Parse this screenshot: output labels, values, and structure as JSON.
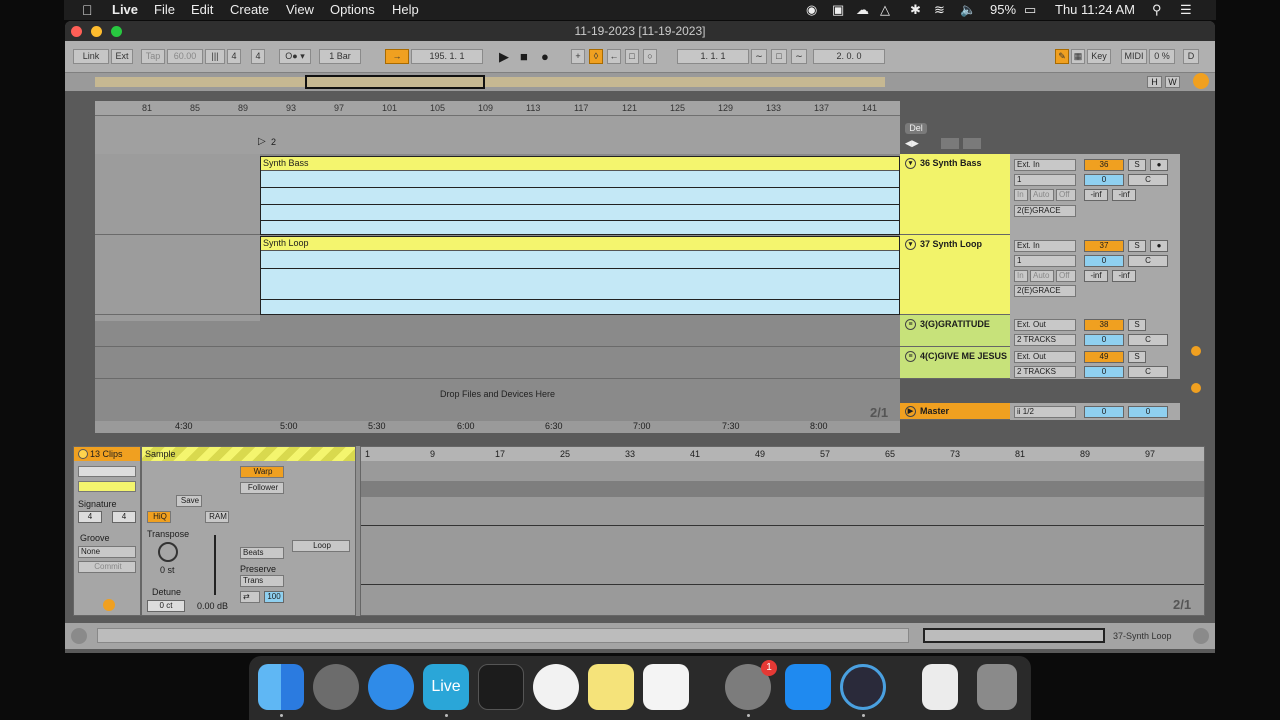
{
  "menubar": {
    "app": "Live",
    "menus": [
      "File",
      "Edit",
      "Create",
      "View",
      "Options",
      "Help"
    ],
    "battery": "95%",
    "clock": "Thu 11:24 AM"
  },
  "window": {
    "title": "11-19-2023  [11-19-2023]"
  },
  "control_bar": {
    "link": "Link",
    "ext": "Ext",
    "tap": "Tap",
    "tempo": "60.00",
    "sig_num": "4",
    "sig_den": "4",
    "quant": "1 Bar",
    "position": "195.   1.   1",
    "loop_start": "1.   1.   1",
    "loop_len": "2.   0.   0",
    "key": "Key",
    "midi": "MIDI",
    "cpu": "0 %",
    "d": "D"
  },
  "ruler": {
    "bars": [
      "81",
      "85",
      "89",
      "93",
      "97",
      "101",
      "105",
      "109",
      "113",
      "117",
      "121",
      "125",
      "129",
      "133",
      "137",
      "141"
    ],
    "loop_marker": "2"
  },
  "time_ruler": [
    "4:30",
    "5:00",
    "5:30",
    "6:00",
    "6:30",
    "7:00",
    "7:30",
    "8:00"
  ],
  "tracks": [
    {
      "name": "36 Synth Bass",
      "clip": "Synth Bass",
      "input_type": "Ext. In",
      "input_channel": "1",
      "monitor": [
        "In",
        "Auto",
        "Off"
      ],
      "route": "2(E)GRACE",
      "number": "36",
      "solo": "S",
      "volume": "0",
      "pan": "C",
      "peak_l": "-inf",
      "peak_r": "-inf"
    },
    {
      "name": "37 Synth Loop",
      "clip": "Synth Loop",
      "input_type": "Ext. In",
      "input_channel": "1",
      "monitor": [
        "In",
        "Auto",
        "Off"
      ],
      "route": "2(E)GRACE",
      "number": "37",
      "solo": "S",
      "volume": "0",
      "pan": "C",
      "peak_l": "-inf",
      "peak_r": "-inf"
    },
    {
      "name": "3(G)GRATITUDE",
      "output": "Ext. Out",
      "tracks": "2 TRACKS",
      "number": "38",
      "solo": "S",
      "volume": "0",
      "pan": "C"
    },
    {
      "name": "4(C)GIVE ME JESUS",
      "output": "Ext. Out",
      "tracks": "2 TRACKS",
      "number": "49",
      "solo": "S",
      "volume": "0",
      "pan": "C"
    }
  ],
  "drop_text": "Drop Files and Devices Here",
  "arrangement_page": "2/1",
  "master": {
    "name": "Master",
    "route": "ii 1/2",
    "volume": "0",
    "pan": "0"
  },
  "side_controls": {
    "del": "Del",
    "h": "H",
    "w": "W"
  },
  "clip_view": {
    "clips_count": "13 Clips",
    "signature_label": "Signature",
    "sig_num": "4",
    "sig_den": "4",
    "groove_label": "Groove",
    "groove": "None",
    "commit": "Commit",
    "sample_label": "Sample",
    "save": "Save",
    "hiq": "HiQ",
    "ram": "RAM",
    "transpose_label": "Transpose",
    "transpose": "0 st",
    "detune_label": "Detune",
    "detune": "0 ct",
    "gain": "0.00 dB",
    "warp": "Warp",
    "follower": "Follower",
    "beats": "Beats",
    "preserve_label": "Preserve",
    "trans": "Trans",
    "grain": "100",
    "loop": "Loop",
    "ruler": [
      "1",
      "9",
      "17",
      "25",
      "33",
      "41",
      "49",
      "57",
      "65",
      "73",
      "81",
      "89",
      "97"
    ],
    "page": "2/1"
  },
  "status": {
    "track": "37-Synth Loop"
  },
  "dock": {
    "apps": [
      "finder-icon",
      "launchpad-icon",
      "safari-icon",
      "live-icon",
      "keyboard-icon",
      "music-icon",
      "notes-icon",
      "onedrive-icon",
      "system-preferences-icon",
      "app-store-icon",
      "quicktime-icon",
      "document-icon",
      "trash-icon"
    ],
    "live_label": "Live",
    "badge": "1"
  }
}
